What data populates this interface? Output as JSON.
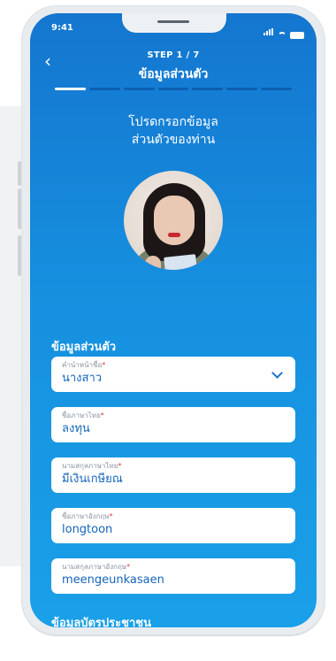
{
  "status": {
    "time": "9:41"
  },
  "header": {
    "step": "STEP 1 / 7",
    "title": "ข้อมูลส่วนตัว",
    "progress_fraction": 0.142857
  },
  "intro": {
    "line1": "โปรดกรอกข้อมูล",
    "line2": "ส่วนตัวของท่าน"
  },
  "sections": {
    "personal": "ข้อมูลส่วนตัว",
    "id_card": "ข้อมูลบัตรประชาชน"
  },
  "fields": [
    {
      "label": "คำนำหน้าชื่อ",
      "value": "นางสาว",
      "type": "select"
    },
    {
      "label": "ชื่อภาษาไทย",
      "value": "ลงทุน",
      "type": "text"
    },
    {
      "label": "นามสกุลภาษาไทย",
      "value": "มีเงินเกษียณ",
      "type": "text"
    },
    {
      "label": "ชื่อภาษาอังกฤษ",
      "value": "longtoon",
      "type": "text"
    },
    {
      "label": "นามสกุลภาษาอังกฤษ",
      "value": "meengeunkasaen",
      "type": "text"
    }
  ],
  "required_mark": "*",
  "icons": {
    "back": "chevron-left-icon",
    "dropdown": "chevron-down-icon"
  },
  "colors": {
    "accent": "#168fdf",
    "field_text": "#1465b8",
    "required": "#e03a3a"
  }
}
